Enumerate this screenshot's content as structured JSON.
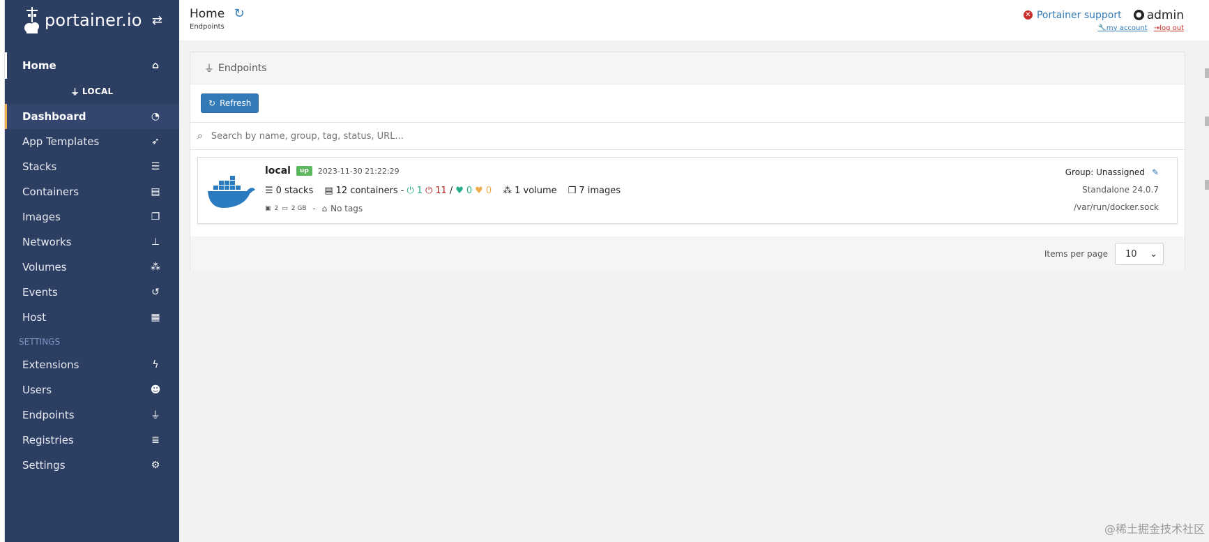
{
  "brand": {
    "name": "portainer.io"
  },
  "sidebar": {
    "home": "Home",
    "endpoint": "LOCAL",
    "items": [
      {
        "label": "Dashboard",
        "icon": "tachometer-icon"
      },
      {
        "label": "App Templates",
        "icon": "rocket-icon"
      },
      {
        "label": "Stacks",
        "icon": "th-list-icon"
      },
      {
        "label": "Containers",
        "icon": "server-icon"
      },
      {
        "label": "Images",
        "icon": "clone-icon"
      },
      {
        "label": "Networks",
        "icon": "sitemap-icon"
      },
      {
        "label": "Volumes",
        "icon": "cubes-icon"
      },
      {
        "label": "Events",
        "icon": "history-icon"
      },
      {
        "label": "Host",
        "icon": "th-icon"
      }
    ],
    "settings_label": "SETTINGS",
    "settings_items": [
      {
        "label": "Extensions",
        "icon": "bolt-icon"
      },
      {
        "label": "Users",
        "icon": "users-icon"
      },
      {
        "label": "Endpoints",
        "icon": "plug-icon"
      },
      {
        "label": "Registries",
        "icon": "database-icon"
      },
      {
        "label": "Settings",
        "icon": "cogs-icon"
      }
    ]
  },
  "header": {
    "title": "Home",
    "breadcrumb": "Endpoints",
    "support": "Portainer support",
    "user": "admin",
    "my_account": "my account",
    "log_out": "log out"
  },
  "panel": {
    "title": "Endpoints",
    "refresh": "Refresh",
    "search_placeholder": "Search by name, group, tag, status, URL..."
  },
  "endpoint": {
    "name": "local",
    "status": "up",
    "timestamp": "2023-11-30 21:22:29",
    "stacks": "0 stacks",
    "containers": "12 containers",
    "running": "1",
    "stopped": "11",
    "healthy": "0",
    "unhealthy": "0",
    "volumes": "1 volume",
    "images": "7 images",
    "cpu": "2",
    "memory": "2 GB",
    "tags": "No tags",
    "group": "Group: Unassigned",
    "version": "Standalone 24.0.7",
    "url": "/var/run/docker.sock"
  },
  "pagination": {
    "label": "Items per page",
    "value": "10"
  },
  "watermark": "@稀土掘金技术社区",
  "colors": {
    "sidebar": "#2d3e63",
    "accent": "#337ab7",
    "up": "#5cb85c",
    "active_border": "#f0ad4e"
  }
}
